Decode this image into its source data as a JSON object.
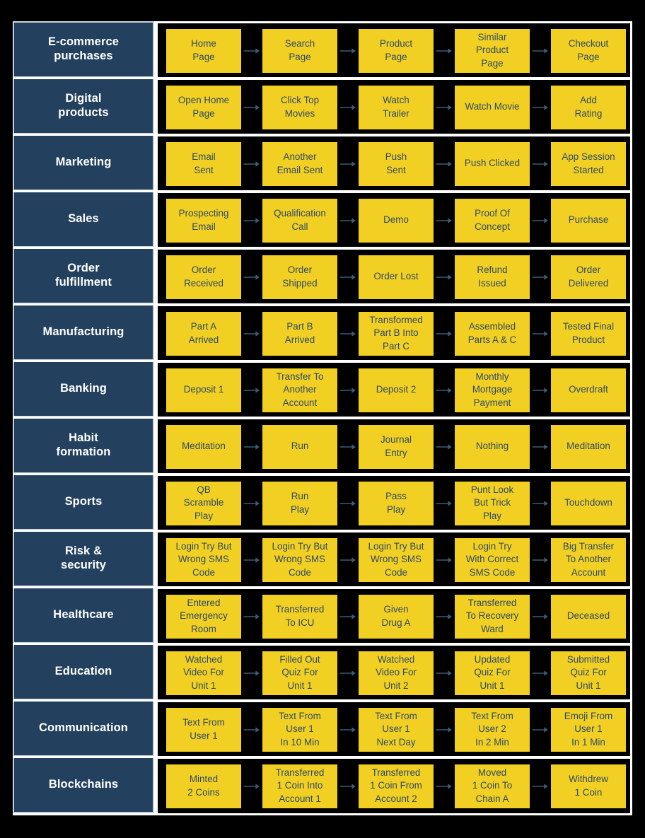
{
  "colors": {
    "background": "#000000",
    "category_fill": "#23415F",
    "category_border": "#c8d2dc",
    "step_fill": "#F2D023",
    "step_text": "#2E4A63",
    "separator": "#ffffff",
    "arrow": "#3A5C79"
  },
  "diagram": {
    "type": "flow-matrix",
    "columns": 5,
    "rows": [
      {
        "category": "E-commerce\npurchases",
        "steps": [
          "Home\nPage",
          "Search\nPage",
          "Product\nPage",
          "Similar\nProduct\nPage",
          "Checkout\nPage"
        ]
      },
      {
        "category": "Digital\nproducts",
        "steps": [
          "Open Home\nPage",
          "Click Top\nMovies",
          "Watch\nTrailer",
          "Watch Movie",
          "Add\nRating"
        ]
      },
      {
        "category": "Marketing",
        "steps": [
          "Email\nSent",
          "Another\nEmail Sent",
          "Push\nSent",
          "Push Clicked",
          "App Session\nStarted"
        ]
      },
      {
        "category": "Sales",
        "steps": [
          "Prospecting\nEmail",
          "Qualification\nCall",
          "Demo",
          "Proof Of\nConcept",
          "Purchase"
        ]
      },
      {
        "category": "Order\nfulfillment",
        "steps": [
          "Order\nReceived",
          "Order\nShipped",
          "Order Lost",
          "Refund\nIssued",
          "Order\nDelivered"
        ]
      },
      {
        "category": "Manufacturing",
        "steps": [
          "Part A\nArrived",
          "Part B\nArrived",
          "Transformed\nPart B Into\nPart C",
          "Assembled\nParts A & C",
          "Tested Final\nProduct"
        ]
      },
      {
        "category": "Banking",
        "steps": [
          "Deposit 1",
          "Transfer To\nAnother\nAccount",
          "Deposit 2",
          "Monthly\nMortgage\nPayment",
          "Overdraft"
        ]
      },
      {
        "category": "Habit\nformation",
        "steps": [
          "Meditation",
          "Run",
          "Journal\nEntry",
          "Nothing",
          "Meditation"
        ]
      },
      {
        "category": "Sports",
        "steps": [
          "QB\nScramble\nPlay",
          "Run\nPlay",
          "Pass\nPlay",
          "Punt Look\nBut Trick\nPlay",
          "Touchdown"
        ]
      },
      {
        "category": "Risk &\nsecurity",
        "steps": [
          "Login Try But\nWrong SMS\nCode",
          "Login Try But\nWrong SMS\nCode",
          "Login Try But\nWrong SMS\nCode",
          "Login Try\nWith Correct\nSMS Code",
          "Big Transfer\nTo Another\nAccount"
        ]
      },
      {
        "category": "Healthcare",
        "steps": [
          "Entered\nEmergency\nRoom",
          "Transferred\nTo ICU",
          "Given\nDrug A",
          "Transferred\nTo Recovery\nWard",
          "Deceased"
        ]
      },
      {
        "category": "Education",
        "steps": [
          "Watched\nVideo For\nUnit 1",
          "Filled Out\nQuiz For\nUnit 1",
          "Watched\nVideo For\nUnit 2",
          "Updated\nQuiz For\nUnit 1",
          "Submitted\nQuiz  For\nUnit 1"
        ]
      },
      {
        "category": "Communication",
        "steps": [
          "Text From\nUser 1",
          "Text From\nUser 1\nIn 10 Min",
          "Text From\nUser 1\nNext Day",
          "Text From\nUser  2\nIn 2 Min",
          "Emoji From\nUser 1\nIn 1 Min"
        ]
      },
      {
        "category": "Blockchains",
        "steps": [
          "Minted\n2 Coins",
          "Transferred\n1 Coin Into\nAccount 1",
          "Transferred\n1 Coin From\nAccount 2",
          "Moved\n1 Coin To\nChain A",
          "Withdrew\n1 Coin"
        ]
      }
    ]
  }
}
